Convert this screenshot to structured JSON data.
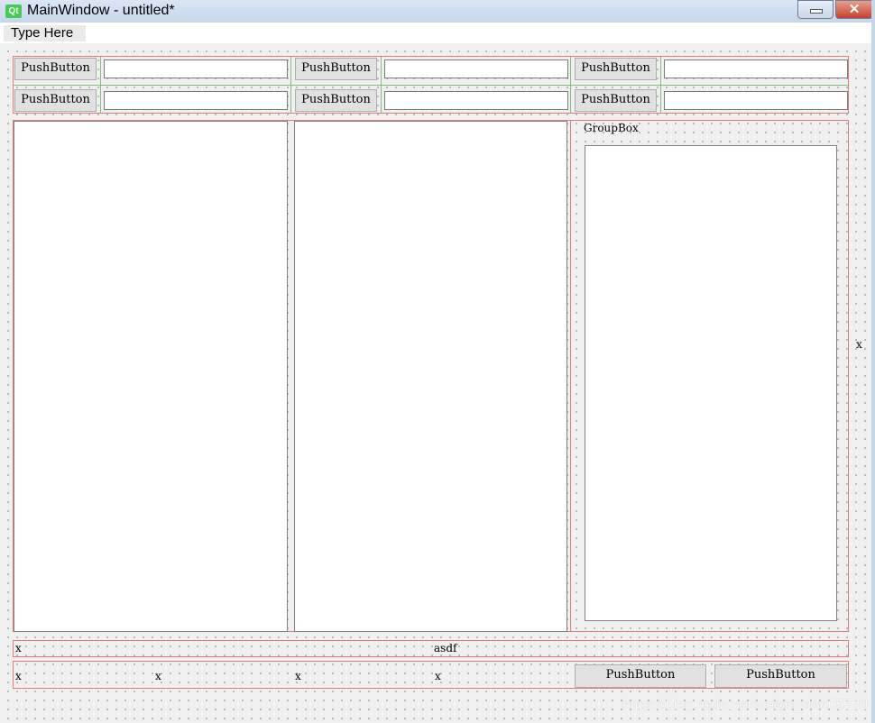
{
  "window": {
    "title": "MainWindow - untitled*",
    "icon": "Qt",
    "close": "✕"
  },
  "menubar": {
    "item": "Type Here"
  },
  "grid": {
    "buttons": [
      "PushButton",
      "PushButton",
      "PushButton",
      "PushButton",
      "PushButton",
      "PushButton"
    ]
  },
  "groupbox": {
    "title": "GroupBox"
  },
  "labels": {
    "side": "x",
    "row1_left": "x",
    "row1_center": "asdf",
    "row2": [
      "x",
      "x",
      "x",
      "x"
    ]
  },
  "bottom_buttons": [
    "PushButton",
    "PushButton"
  ],
  "watermark": "https://blog.csdn.net/weixin_44405720"
}
